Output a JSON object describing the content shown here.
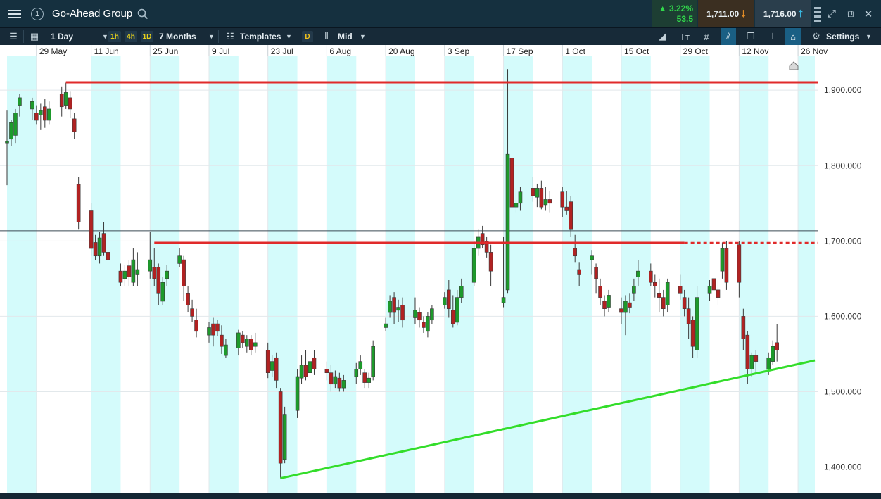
{
  "header": {
    "instrument_name": "Go-Ahead Group",
    "change_pct": "3.22%",
    "change_abs": "53.5",
    "sell_price": "1,711.00",
    "buy_price": "1,716.00",
    "colors": {
      "up": "#31d84b",
      "sell_arrow": "#e08a26",
      "buy_arrow": "#39b7e0"
    }
  },
  "toolbar": {
    "interval": "1 Day",
    "timeframes": [
      "1h",
      "4h",
      "1D"
    ],
    "range": "7 Months",
    "templates_label": "Templates",
    "price_type_chip": "D",
    "price_type": "Mid",
    "settings_label": "Settings"
  },
  "icons": [
    "menu-icon",
    "info-icon",
    "search-icon",
    "list-icon",
    "layout-icon",
    "templates-icon",
    "candles-icon",
    "draw-line-icon",
    "text-icon",
    "grid-icon",
    "trend-tool-icon",
    "copy-icon",
    "measure-icon",
    "label-icon",
    "gear-icon",
    "minimize-icon",
    "expand-icon",
    "popout-icon",
    "close-icon",
    "scroll-to-end-icon"
  ],
  "chart_data": {
    "type": "candlestick",
    "title": "",
    "ylim": [
      1365,
      1945
    ],
    "y_ticks": [
      "1,400.000",
      "1,500.000",
      "1,600.000",
      "1,700.000",
      "1,800.000",
      "1,900.000"
    ],
    "x_range": [
      "2018-05-22",
      "2018-11-30"
    ],
    "x_ticks": [
      {
        "date": "2018-05-29",
        "label": "29 May"
      },
      {
        "date": "2018-06-11",
        "label": "11 Jun"
      },
      {
        "date": "2018-06-25",
        "label": "25 Jun"
      },
      {
        "date": "2018-07-09",
        "label": "9 Jul"
      },
      {
        "date": "2018-07-23",
        "label": "23 Jul"
      },
      {
        "date": "2018-08-06",
        "label": "6 Aug"
      },
      {
        "date": "2018-08-20",
        "label": "20 Aug"
      },
      {
        "date": "2018-09-03",
        "label": "3 Sep"
      },
      {
        "date": "2018-09-17",
        "label": "17 Sep"
      },
      {
        "date": "2018-10-01",
        "label": "1 Oct"
      },
      {
        "date": "2018-10-15",
        "label": "15 Oct"
      },
      {
        "date": "2018-10-29",
        "label": "29 Oct"
      },
      {
        "date": "2018-11-12",
        "label": "12 Nov"
      },
      {
        "date": "2018-11-26",
        "label": "26 Nov"
      }
    ],
    "shaded_periods": [
      [
        "2018-05-22",
        "2018-05-29"
      ],
      [
        "2018-06-11",
        "2018-06-18"
      ],
      [
        "2018-06-25",
        "2018-07-02"
      ],
      [
        "2018-07-09",
        "2018-07-16"
      ],
      [
        "2018-07-23",
        "2018-07-30"
      ],
      [
        "2018-08-06",
        "2018-08-13"
      ],
      [
        "2018-08-20",
        "2018-08-27"
      ],
      [
        "2018-09-03",
        "2018-09-10"
      ],
      [
        "2018-09-17",
        "2018-09-24"
      ],
      [
        "2018-10-01",
        "2018-10-08"
      ],
      [
        "2018-10-15",
        "2018-10-22"
      ],
      [
        "2018-10-29",
        "2018-11-05"
      ],
      [
        "2018-11-12",
        "2018-11-19"
      ],
      [
        "2018-11-26",
        "2018-11-30"
      ]
    ],
    "candles": [
      [
        "2018-05-22",
        1830,
        1832,
        1873,
        1774
      ],
      [
        "2018-05-23",
        1835,
        1857,
        1860,
        1826
      ],
      [
        "2018-05-24",
        1840,
        1870,
        1875,
        1830
      ],
      [
        "2018-05-25",
        1880,
        1890,
        1895,
        1865
      ],
      [
        "2018-05-28",
        1875,
        1885,
        1890,
        1860
      ],
      [
        "2018-05-29",
        1870,
        1860,
        1880,
        1855
      ],
      [
        "2018-05-30",
        1867,
        1873,
        1882,
        1848
      ],
      [
        "2018-05-31",
        1878,
        1860,
        1888,
        1850
      ],
      [
        "2018-06-01",
        1860,
        1875,
        1885,
        1855
      ],
      [
        "2018-06-04",
        1895,
        1878,
        1905,
        1865
      ],
      [
        "2018-06-05",
        1880,
        1897,
        1910,
        1875
      ],
      [
        "2018-06-06",
        1890,
        1875,
        1898,
        1863
      ],
      [
        "2018-06-07",
        1862,
        1845,
        1870,
        1835
      ],
      [
        "2018-06-08",
        1775,
        1725,
        1785,
        1715
      ],
      [
        "2018-06-11",
        1740,
        1690,
        1750,
        1680
      ],
      [
        "2018-06-12",
        1698,
        1680,
        1708,
        1675
      ],
      [
        "2018-06-13",
        1680,
        1704,
        1712,
        1670
      ],
      [
        "2018-06-14",
        1710,
        1685,
        1725,
        1680
      ],
      [
        "2018-06-15",
        1685,
        1675,
        1695,
        1665
      ],
      [
        "2018-06-18",
        1660,
        1645,
        1670,
        1640
      ],
      [
        "2018-06-19",
        1650,
        1660,
        1668,
        1640
      ],
      [
        "2018-06-20",
        1667,
        1652,
        1675,
        1640
      ],
      [
        "2018-06-21",
        1645,
        1675,
        1690,
        1640
      ],
      [
        "2018-06-22",
        1655,
        1662,
        1685,
        1640
      ],
      [
        "2018-06-25",
        1660,
        1675,
        1712,
        1650
      ],
      [
        "2018-06-26",
        1665,
        1650,
        1690,
        1640
      ],
      [
        "2018-06-27",
        1665,
        1630,
        1670,
        1615
      ],
      [
        "2018-06-28",
        1620,
        1645,
        1652,
        1615
      ],
      [
        "2018-06-29",
        1650,
        1660,
        1668,
        1640
      ],
      [
        "2018-07-02",
        1670,
        1680,
        1690,
        1665
      ],
      [
        "2018-07-03",
        1675,
        1640,
        1680,
        1620
      ],
      [
        "2018-07-04",
        1630,
        1615,
        1640,
        1605
      ],
      [
        "2018-07-05",
        1610,
        1600,
        1622,
        1592
      ],
      [
        "2018-07-06",
        1595,
        1580,
        1610,
        1572
      ],
      [
        "2018-07-09",
        1575,
        1585,
        1592,
        1565
      ],
      [
        "2018-07-10",
        1590,
        1575,
        1598,
        1560
      ],
      [
        "2018-07-11",
        1590,
        1580,
        1595,
        1574
      ],
      [
        "2018-07-12",
        1575,
        1560,
        1588,
        1550
      ],
      [
        "2018-07-13",
        1548,
        1562,
        1570,
        1545
      ],
      [
        "2018-07-16",
        1558,
        1578,
        1582,
        1548
      ],
      [
        "2018-07-17",
        1575,
        1565,
        1580,
        1558
      ],
      [
        "2018-07-18",
        1560,
        1570,
        1575,
        1552
      ],
      [
        "2018-07-19",
        1570,
        1555,
        1575,
        1548
      ],
      [
        "2018-07-20",
        1560,
        1565,
        1578,
        1552
      ],
      [
        "2018-07-23",
        1555,
        1525,
        1565,
        1518
      ],
      [
        "2018-07-24",
        1528,
        1540,
        1548,
        1520
      ],
      [
        "2018-07-25",
        1545,
        1515,
        1552,
        1505
      ],
      [
        "2018-07-26",
        1500,
        1405,
        1505,
        1385
      ],
      [
        "2018-07-27",
        1410,
        1470,
        1480,
        1405
      ],
      [
        "2018-07-30",
        1475,
        1520,
        1530,
        1465
      ],
      [
        "2018-07-31",
        1518,
        1535,
        1548,
        1510
      ],
      [
        "2018-08-01",
        1535,
        1520,
        1555,
        1515
      ],
      [
        "2018-08-02",
        1525,
        1540,
        1558,
        1518
      ],
      [
        "2018-08-03",
        1545,
        1530,
        1555,
        1522
      ],
      [
        "2018-08-06",
        1530,
        1525,
        1540,
        1515
      ],
      [
        "2018-08-07",
        1525,
        1510,
        1535,
        1500
      ],
      [
        "2018-08-08",
        1510,
        1520,
        1528,
        1505
      ],
      [
        "2018-08-09",
        1518,
        1505,
        1525,
        1500
      ],
      [
        "2018-08-10",
        1505,
        1515,
        1522,
        1500
      ],
      [
        "2018-08-13",
        1520,
        1530,
        1538,
        1510
      ],
      [
        "2018-08-14",
        1530,
        1540,
        1548,
        1522
      ],
      [
        "2018-08-15",
        1525,
        1512,
        1530,
        1505
      ],
      [
        "2018-08-16",
        1512,
        1518,
        1525,
        1505
      ],
      [
        "2018-08-17",
        1520,
        1560,
        1568,
        1515
      ],
      [
        "2018-08-20",
        1585,
        1590,
        1598,
        1580
      ],
      [
        "2018-08-21",
        1605,
        1620,
        1628,
        1598
      ],
      [
        "2018-08-22",
        1625,
        1605,
        1632,
        1590
      ],
      [
        "2018-08-23",
        1608,
        1612,
        1622,
        1592
      ],
      [
        "2018-08-24",
        1615,
        1595,
        1625,
        1585
      ],
      [
        "2018-08-27",
        1598,
        1608,
        1625,
        1590
      ],
      [
        "2018-08-28",
        1605,
        1595,
        1612,
        1585
      ],
      [
        "2018-08-29",
        1592,
        1585,
        1600,
        1578
      ],
      [
        "2018-08-30",
        1580,
        1600,
        1605,
        1572
      ],
      [
        "2018-08-31",
        1595,
        1610,
        1615,
        1590
      ],
      [
        "2018-09-03",
        1615,
        1625,
        1632,
        1610
      ],
      [
        "2018-09-04",
        1635,
        1610,
        1648,
        1598
      ],
      [
        "2018-09-05",
        1608,
        1590,
        1628,
        1585
      ],
      [
        "2018-09-06",
        1592,
        1625,
        1635,
        1588
      ],
      [
        "2018-09-07",
        1625,
        1640,
        1650,
        1618
      ],
      [
        "2018-09-10",
        1645,
        1690,
        1700,
        1640
      ],
      [
        "2018-09-11",
        1690,
        1705,
        1715,
        1680
      ],
      [
        "2018-09-12",
        1710,
        1695,
        1720,
        1690
      ],
      [
        "2018-09-13",
        1700,
        1685,
        1705,
        1678
      ],
      [
        "2018-09-14",
        1685,
        1660,
        1695,
        1640
      ],
      [
        "2018-09-17",
        1618,
        1625,
        1705,
        1612
      ],
      [
        "2018-09-18",
        1635,
        1815,
        1928,
        1630
      ],
      [
        "2018-09-19",
        1810,
        1745,
        1815,
        1720
      ],
      [
        "2018-09-20",
        1745,
        1750,
        1770,
        1738
      ],
      [
        "2018-09-21",
        1750,
        1765,
        1772,
        1740
      ],
      [
        "2018-09-24",
        1770,
        1760,
        1785,
        1752
      ],
      [
        "2018-09-25",
        1758,
        1770,
        1776,
        1745
      ],
      [
        "2018-09-26",
        1770,
        1745,
        1780,
        1742
      ],
      [
        "2018-09-27",
        1748,
        1755,
        1772,
        1740
      ],
      [
        "2018-09-28",
        1755,
        1750,
        1766,
        1738
      ],
      [
        "2018-10-01",
        1765,
        1745,
        1772,
        1732
      ],
      [
        "2018-10-02",
        1745,
        1740,
        1766,
        1735
      ],
      [
        "2018-10-03",
        1752,
        1715,
        1760,
        1705
      ],
      [
        "2018-10-04",
        1690,
        1680,
        1708,
        1672
      ],
      [
        "2018-10-05",
        1662,
        1655,
        1672,
        1640
      ],
      [
        "2018-10-08",
        1675,
        1680,
        1688,
        1655
      ],
      [
        "2018-10-09",
        1665,
        1650,
        1670,
        1630
      ],
      [
        "2018-10-10",
        1640,
        1625,
        1650,
        1615
      ],
      [
        "2018-10-11",
        1620,
        1610,
        1628,
        1600
      ],
      [
        "2018-10-12",
        1612,
        1628,
        1635,
        1605
      ],
      [
        "2018-10-15",
        1610,
        1605,
        1625,
        1590
      ],
      [
        "2018-10-16",
        1605,
        1620,
        1628,
        1575
      ],
      [
        "2018-10-17",
        1618,
        1612,
        1630,
        1604
      ],
      [
        "2018-10-18",
        1630,
        1640,
        1650,
        1620
      ],
      [
        "2018-10-19",
        1652,
        1660,
        1675,
        1640
      ],
      [
        "2018-10-22",
        1660,
        1645,
        1670,
        1640
      ],
      [
        "2018-10-23",
        1645,
        1640,
        1655,
        1625
      ],
      [
        "2018-10-24",
        1630,
        1625,
        1650,
        1605
      ],
      [
        "2018-10-25",
        1625,
        1610,
        1635,
        1600
      ],
      [
        "2018-10-26",
        1615,
        1645,
        1650,
        1605
      ],
      [
        "2018-10-29",
        1640,
        1630,
        1655,
        1622
      ],
      [
        "2018-10-30",
        1625,
        1610,
        1635,
        1600
      ],
      [
        "2018-10-31",
        1610,
        1590,
        1625,
        1570
      ],
      [
        "2018-11-01",
        1595,
        1560,
        1600,
        1545
      ],
      [
        "2018-11-02",
        1555,
        1625,
        1640,
        1545
      ],
      [
        "2018-11-05",
        1630,
        1640,
        1648,
        1620
      ],
      [
        "2018-11-06",
        1650,
        1635,
        1658,
        1620
      ],
      [
        "2018-11-07",
        1635,
        1625,
        1648,
        1615
      ],
      [
        "2018-11-08",
        1660,
        1690,
        1698,
        1650
      ],
      [
        "2018-11-09",
        1690,
        1645,
        1700,
        1635
      ],
      [
        "2018-11-12",
        1695,
        1645,
        1700,
        1625
      ],
      [
        "2018-11-13",
        1600,
        1570,
        1610,
        1555
      ]
    ],
    "candles_late": [
      [
        "2018-11-14",
        1575,
        1530,
        1580,
        1510
      ],
      [
        "2018-11-15",
        1530,
        1548,
        1552,
        1520
      ],
      [
        "2018-11-16",
        1548,
        1540,
        1555,
        1525
      ],
      [
        "2018-11-19",
        1530,
        1545,
        1552,
        1522
      ],
      [
        "2018-11-20",
        1540,
        1560,
        1568,
        1535
      ],
      [
        "2018-11-21",
        1565,
        1555,
        1590,
        1540
      ]
    ],
    "horizontal_lines": [
      {
        "name": "resistance-1910",
        "value": 1910.5,
        "label": "1,910.500",
        "from": "2018-06-05",
        "color": "#e02a2a",
        "style": "solid"
      },
      {
        "name": "resistance-1697",
        "value": 1697.5,
        "label": "1,697.500",
        "from": "2018-06-26",
        "to": "2018-10-30",
        "color": "#e02a2a",
        "style": "solid",
        "extend": "dashed"
      },
      {
        "name": "current-price",
        "value": 1713.5,
        "label": "1,713.500",
        "color": "#3a4a55",
        "style": "solid"
      }
    ],
    "trendline": {
      "name": "support-trend",
      "from": [
        "2018-07-26",
        1385
      ],
      "to": [
        "2018-11-30",
        1541.434
      ],
      "label": "1,541.434",
      "color": "#33dd2a"
    }
  }
}
